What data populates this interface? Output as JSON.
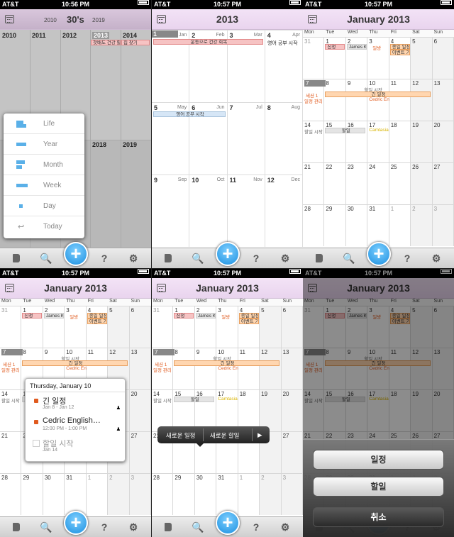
{
  "status": {
    "carrier": "AT&T",
    "times": [
      "10:56 PM",
      "10:57 PM",
      "10:57 PM",
      "10:57 PM",
      "10:57 PM",
      "10:57 PM"
    ]
  },
  "panel1": {
    "decade": "30's",
    "prev_year": "2010",
    "next_year": "2019",
    "years_row1": [
      "2010",
      "2011",
      "2012",
      "2013",
      "2014"
    ],
    "years_row2": [
      "2018",
      "2019"
    ],
    "events": [
      "첫배도 건강 활",
      "집 찾기"
    ],
    "menu": [
      "Life",
      "Year",
      "Month",
      "Week",
      "Day",
      "Today"
    ]
  },
  "panel2": {
    "title": "2013",
    "months": [
      {
        "n": "1",
        "m": "Jan"
      },
      {
        "n": "2",
        "m": "Feb"
      },
      {
        "n": "3",
        "m": "Mar"
      },
      {
        "n": "4",
        "m": "Apr"
      },
      {
        "n": "5",
        "m": "May"
      },
      {
        "n": "6",
        "m": "Jun"
      },
      {
        "n": "7",
        "m": "Jul"
      },
      {
        "n": "8",
        "m": "Aug"
      },
      {
        "n": "9",
        "m": "Sep"
      },
      {
        "n": "10",
        "m": "Oct"
      },
      {
        "n": "11",
        "m": "Nov"
      },
      {
        "n": "12",
        "m": "Dec"
      }
    ],
    "events": [
      "운동으로 건강 회복",
      "영어 공부 시작",
      "영어 공부 시작"
    ]
  },
  "month": {
    "title": "January 2013",
    "dow": [
      "Mon",
      "Tue",
      "Wed",
      "Thu",
      "Fri",
      "Sat",
      "Sun"
    ],
    "weeks": [
      [
        "31",
        "1",
        "2",
        "3",
        "4",
        "5",
        "6"
      ],
      [
        "7",
        "8",
        "9",
        "10",
        "11",
        "12",
        "13"
      ],
      [
        "14",
        "15",
        "16",
        "17",
        "18",
        "19",
        "20"
      ],
      [
        "21",
        "22",
        "23",
        "24",
        "25",
        "26",
        "27"
      ],
      [
        "28",
        "29",
        "30",
        "31",
        "1",
        "2",
        "3"
      ]
    ],
    "ev": {
      "sinjeong": "신정",
      "james": "James Ki",
      "ilbang": "일방",
      "jongil": "종일 일정",
      "event": "이벤트 기",
      "halil": "할일 시작",
      "long": "긴 일정",
      "session": "세션 1",
      "ilpan": "일정 관리",
      "cedric": "Cedric En",
      "halil2": "할일",
      "camtasia": "Camtasia"
    }
  },
  "popover": {
    "header": "Thursday, January 10",
    "items": [
      {
        "title": "긴 일정",
        "sub": "Jan 8 - Jan 12"
      },
      {
        "title": "Cedric English…",
        "sub": "12:00 PM - 1:00 PM"
      },
      {
        "title": "할일 시작",
        "sub": "Jan 14"
      }
    ]
  },
  "bubble": {
    "new_event": "새로운 일정",
    "new_task": "새로운 할일",
    "more": "▶"
  },
  "sheet": {
    "event": "일정",
    "task": "할일",
    "cancel": "취소"
  },
  "tabbar": {
    "search": "🔍",
    "help": "?",
    "settings": "⚙",
    "plus": "+"
  }
}
